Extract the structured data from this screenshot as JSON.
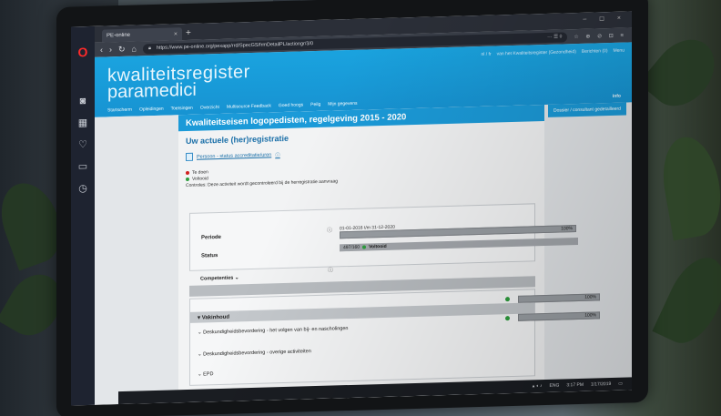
{
  "browser": {
    "tab_title": "PE-online",
    "url": "https://www.pe-online.org/pexapp/rrd/SpecGS/frmDetailPL/actiongr/3/0",
    "url_icons": "··· ☰ ◊",
    "tools": "☆ ⊕ ⊘ ⊡ ≡",
    "window_controls": "– ◻ ×"
  },
  "opera_sidebar": [
    "opera-logo-icon",
    "camera-icon",
    "speed-dial-icon",
    "heart-icon",
    "news-icon",
    "history-icon"
  ],
  "site": {
    "logo_line1": "kwaliteitsregister",
    "logo_line2": "paramedici",
    "top_links": [
      "nl / fr",
      "van het Kwaliteitsregister (Gezondheid)",
      "Berichten (0)",
      "Menu"
    ],
    "nav": [
      "Startscherm",
      "Opleidingen",
      "Toetsingen",
      "Overzicht",
      "Multisource Feedback",
      "Goed hoogs",
      "Peilg",
      "Mijn gegevens"
    ],
    "nav_info": "Info",
    "side_button": "Dossier / consultant gedetailleerd"
  },
  "page": {
    "header": "Kwaliteitseisen logopedisten, regelgeving 2015 - 2020",
    "title": "Uw actuele (her)registratie",
    "person_link": "Persoon - status accreditatie/uren",
    "legend": [
      {
        "text": "Te doen",
        "color": "#d12020"
      },
      {
        "text": "Voltooid",
        "color": "#2e9e3e"
      }
    ],
    "legend_note": "Controles: Deze activiteit wordt gecontroleerd bij de herregistratie aanvraag",
    "periode_label": "Periode",
    "periode_value": "01-01-2016 t/m 31-12-2020",
    "periode_pct": "100%",
    "periode_progress": 1.0,
    "status_label": "Status",
    "status_value": "Voltooid",
    "status_count": "497/160",
    "competenties": "Competenties",
    "vakgebied_pct": "100%",
    "vakgebied_progress": 1.0,
    "section_title": "Vakinhoud",
    "rows": [
      {
        "label": "Deskundigheidsbevordering - het volgen van bij- en nascholingen",
        "pct": "100%",
        "progress": 1.0
      },
      {
        "label": "Deskundigheidsbevordering - overige activiteiten"
      },
      {
        "label": "EPD"
      }
    ]
  },
  "taskbar": {
    "lang": "ENG",
    "time": "3:17 PM",
    "date": "1/17/2019"
  }
}
